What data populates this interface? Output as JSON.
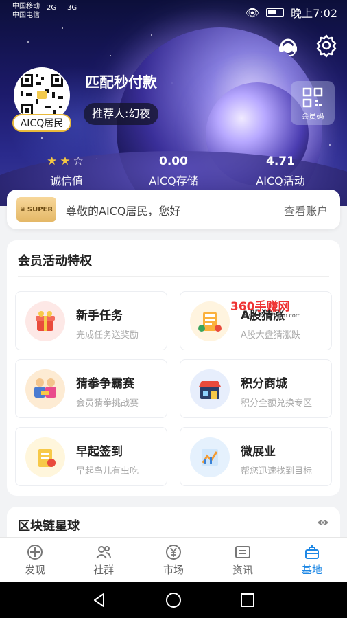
{
  "status_bar": {
    "carrier1": "中国移动",
    "carrier2": "中国电信",
    "sig1": "2G",
    "sig2": "3G",
    "time": "晚上7:02"
  },
  "profile": {
    "username": "匹配秒付款",
    "referrer": "推荐人:幻夜",
    "badge": "AICQ居民",
    "member_code_label": "会员码"
  },
  "stats": [
    {
      "value": "",
      "label": "诚信值",
      "stars_filled": 2,
      "stars_total": 3
    },
    {
      "value": "0.00",
      "label": "AICQ存储"
    },
    {
      "value": "4.71",
      "label": "AICQ活动"
    }
  ],
  "greeting": {
    "badge": "SUPER",
    "text": "尊敬的AICQ居民，您好",
    "link": "查看账户"
  },
  "privileges": {
    "title": "会员活动特权",
    "items": [
      {
        "title": "新手任务",
        "subtitle": "完成任务送奖励",
        "icon": "gift-icon"
      },
      {
        "title": "A股猜涨",
        "subtitle": "A股大盘猜涨跌",
        "icon": "stock-guess-icon"
      },
      {
        "title": "猜拳争霸赛",
        "subtitle": "会员猜拳挑战赛",
        "icon": "rps-contest-icon"
      },
      {
        "title": "积分商城",
        "subtitle": "积分全额兑换专区",
        "icon": "shop-icon"
      },
      {
        "title": "早起签到",
        "subtitle": "早起鸟儿有虫吃",
        "icon": "checkin-icon"
      },
      {
        "title": "微展业",
        "subtitle": "帮您迅速找到目标",
        "icon": "chart-icon"
      }
    ]
  },
  "watermark": {
    "text": "360手赚网",
    "sub": "www.shouzhuan.com"
  },
  "blockchain": {
    "title": "区块链星球"
  },
  "tabs": [
    {
      "label": "发现"
    },
    {
      "label": "社群"
    },
    {
      "label": "市场"
    },
    {
      "label": "资讯"
    },
    {
      "label": "基地"
    }
  ]
}
